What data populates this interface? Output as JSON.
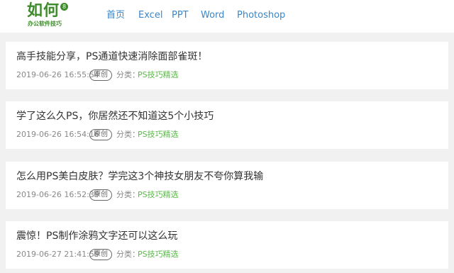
{
  "logo": {
    "main": "如何",
    "badge": "8",
    "sub": "办公软件技巧"
  },
  "nav": [
    "首页",
    "Excel",
    "PPT",
    "Word",
    "Photoshop"
  ],
  "articles": [
    {
      "title": "高手技能分享，PS通道快速消除面部雀斑！",
      "date": "2019-06-26 16:55:54",
      "badge": "原创",
      "category_label": "分类：",
      "category": "PS技巧精选"
    },
    {
      "title": "学了这么久PS，你居然还不知道这5个小技巧",
      "date": "2019-06-26 16:54:16",
      "badge": "原创",
      "category_label": "分类：",
      "category": "PS技巧精选"
    },
    {
      "title": "怎么用PS美白皮肤？学完这3个神技女朋友不夸你算我输",
      "date": "2019-06-26 16:52:39",
      "badge": "原创",
      "category_label": "分类：",
      "category": "PS技巧精选"
    },
    {
      "title": "震惊！PS制作涂鸦文字还可以这么玩",
      "date": "2019-06-27 21:41:59",
      "badge": "原创",
      "category_label": "分类：",
      "category": "PS技巧精选"
    }
  ]
}
